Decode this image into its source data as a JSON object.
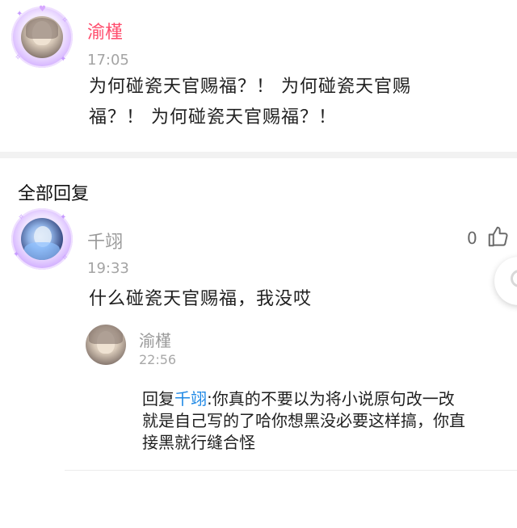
{
  "post": {
    "author": "渝槿",
    "time": "17:05",
    "text_lines": [
      "为何碰瓷天官赐福？！ 为何碰瓷天官赐",
      "福？！ 为何碰瓷天官赐福？！"
    ],
    "avatar_icon": "anime-girl-avatar"
  },
  "replies_section": {
    "title": "全部回复"
  },
  "reply": {
    "author": "千翊",
    "time": "19:33",
    "text": "什么碰瓷天官赐福，我没哎",
    "like_count": "0",
    "like_icon": "thumbs-up-icon"
  },
  "sub_reply": {
    "author": "渝槿",
    "time": "22:56",
    "prefix": "回复",
    "mention": "千翊",
    "line1": ":你真的不要以为将小说原句改一改",
    "line2": "就是自己写的了哈你想黑没必要这样搞，你直",
    "line3": "接黑就行缝合怪"
  },
  "colors": {
    "author_highlight": "#ff4d6d",
    "mention": "#1e88e5",
    "muted": "#9a9a9a"
  }
}
